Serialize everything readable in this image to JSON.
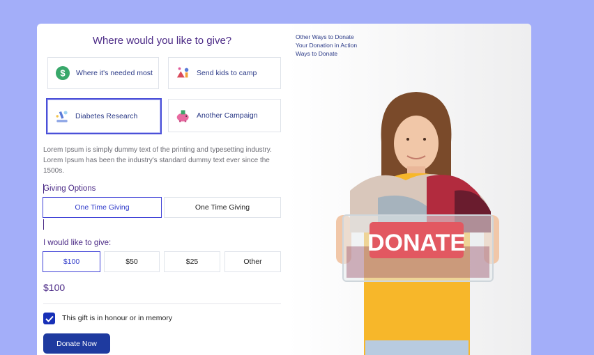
{
  "heading": "Where would you like to give?",
  "campaigns": [
    {
      "label": "Where it's needed most",
      "icon": "dollar-coin-icon"
    },
    {
      "label": "Send kids to camp",
      "icon": "camp-kids-icon"
    },
    {
      "label": "Diabetes Research",
      "icon": "microscope-research-icon",
      "selected": true
    },
    {
      "label": "Another Campaign",
      "icon": "piggy-bank-icon"
    }
  ],
  "description": "Lorem Ipsum is simply dummy text of the printing and typesetting industry. Lorem Ipsum has been the industry's standard dummy text ever since the 1500s.",
  "giving_options": {
    "label": "Giving Options",
    "options": [
      "One Time Giving",
      "One Time Giving"
    ],
    "selected_index": 0
  },
  "amounts": {
    "label": "I would like to give:",
    "options": [
      "$100",
      "$50",
      "$25",
      "Other"
    ],
    "selected_index": 0
  },
  "total": "$100",
  "honour": {
    "label": "This gift is in honour or in memory",
    "checked": true
  },
  "donate_button": "Donate Now",
  "side_links": [
    "Other Ways to Donate",
    "Your Donation in Action",
    "Ways to Donate"
  ],
  "photo": {
    "sign_text": "DONATE"
  },
  "colors": {
    "page_bg": "#a3aef9",
    "accent": "#4b2a86",
    "primary": "#1e3a9f",
    "selected_border": "#3d3fd6"
  }
}
